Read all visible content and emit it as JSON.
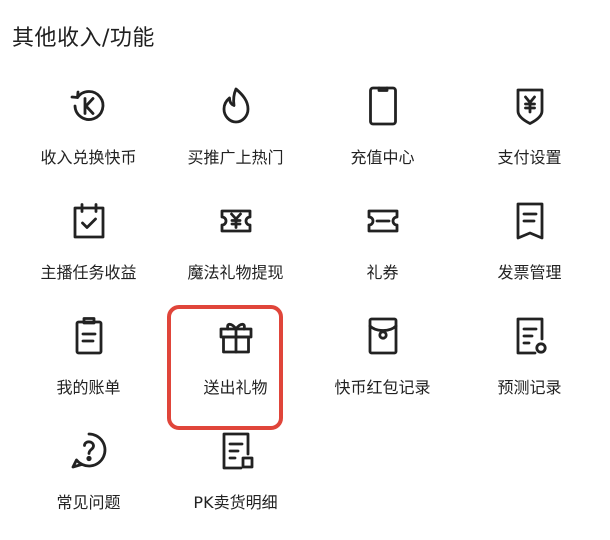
{
  "section": {
    "title": "其他收入/功能"
  },
  "colors": {
    "icon_stroke": "#222222",
    "highlight": "#E0453A"
  },
  "items": [
    {
      "label": "收入兑换快币",
      "icon": "k-coin-exchange-icon"
    },
    {
      "label": "买推广上热门",
      "icon": "flame-icon"
    },
    {
      "label": "充值中心",
      "icon": "phone-icon"
    },
    {
      "label": "支付设置",
      "icon": "yuan-shield-icon"
    },
    {
      "label": "主播任务收益",
      "icon": "calendar-check-icon"
    },
    {
      "label": "魔法礼物提现",
      "icon": "yuan-ticket-icon"
    },
    {
      "label": "礼券",
      "icon": "coupon-icon"
    },
    {
      "label": "发票管理",
      "icon": "invoice-icon"
    },
    {
      "label": "我的账单",
      "icon": "bill-icon"
    },
    {
      "label": "送出礼物",
      "icon": "gift-icon",
      "highlighted": true
    },
    {
      "label": "快币红包记录",
      "icon": "red-packet-icon"
    },
    {
      "label": "预测记录",
      "icon": "prediction-record-icon"
    },
    {
      "label": "常见问题",
      "icon": "question-bubble-icon"
    },
    {
      "label": "PK卖货明细",
      "icon": "pk-sales-detail-icon"
    }
  ]
}
